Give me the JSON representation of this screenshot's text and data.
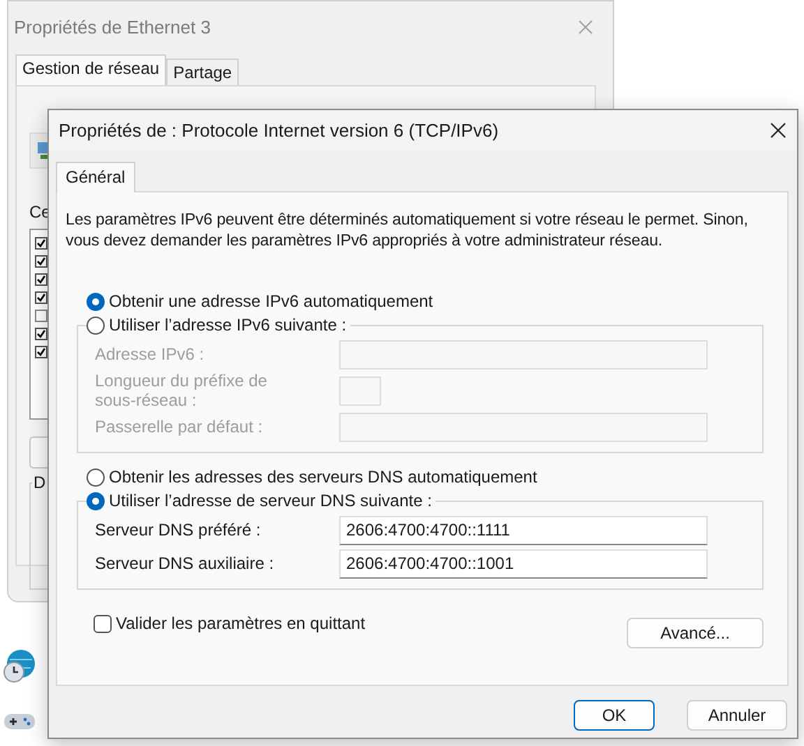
{
  "back_window": {
    "title": "Propriétés de Ethernet 3",
    "tabs": [
      {
        "label": "Gestion de réseau",
        "selected": true
      },
      {
        "label": "Partage",
        "selected": false
      }
    ],
    "components_label": "Ce",
    "components": [
      {
        "checked": true
      },
      {
        "checked": true
      },
      {
        "checked": true
      },
      {
        "checked": true
      },
      {
        "checked": false
      },
      {
        "checked": true
      },
      {
        "checked": true
      }
    ],
    "group_label": "D"
  },
  "dialog": {
    "title": "Propriétés de : Protocole Internet version 6 (TCP/IPv6)",
    "tabs": [
      {
        "label": "Général",
        "selected": true
      }
    ],
    "description": "Les paramètres IPv6 peuvent être déterminés automatiquement si votre réseau le permet. Sinon, vous devez demander les paramètres IPv6 appropriés à votre administrateur réseau.",
    "address_options": [
      {
        "label": "Obtenir une adresse IPv6 automatiquement",
        "selected": true
      },
      {
        "label": "Utiliser l’adresse IPv6 suivante :",
        "selected": false
      }
    ],
    "address_fields": [
      {
        "label": "Adresse IPv6 :",
        "kind": "wide"
      },
      {
        "label": "Longueur du préfixe de sous-réseau :",
        "kind": "short"
      },
      {
        "label": "Passerelle par défaut :",
        "kind": "wide"
      }
    ],
    "dns_options": [
      {
        "label": "Obtenir les adresses des serveurs DNS automatiquement",
        "selected": false
      },
      {
        "label": "Utiliser l’adresse de serveur DNS suivante :",
        "selected": true
      }
    ],
    "dns_fields": [
      {
        "label": "Serveur DNS préféré :",
        "value": "2606:4700:4700::1111"
      },
      {
        "label": "Serveur DNS auxiliaire :",
        "value": "2606:4700:4700::1001"
      }
    ],
    "validate": {
      "label": "Valider les paramètres en quittant",
      "checked": false
    },
    "advanced_button": "Avancé...",
    "buttons": [
      {
        "label": "OK",
        "kind": "default"
      },
      {
        "label": "Annuler",
        "kind": "normal"
      }
    ]
  }
}
